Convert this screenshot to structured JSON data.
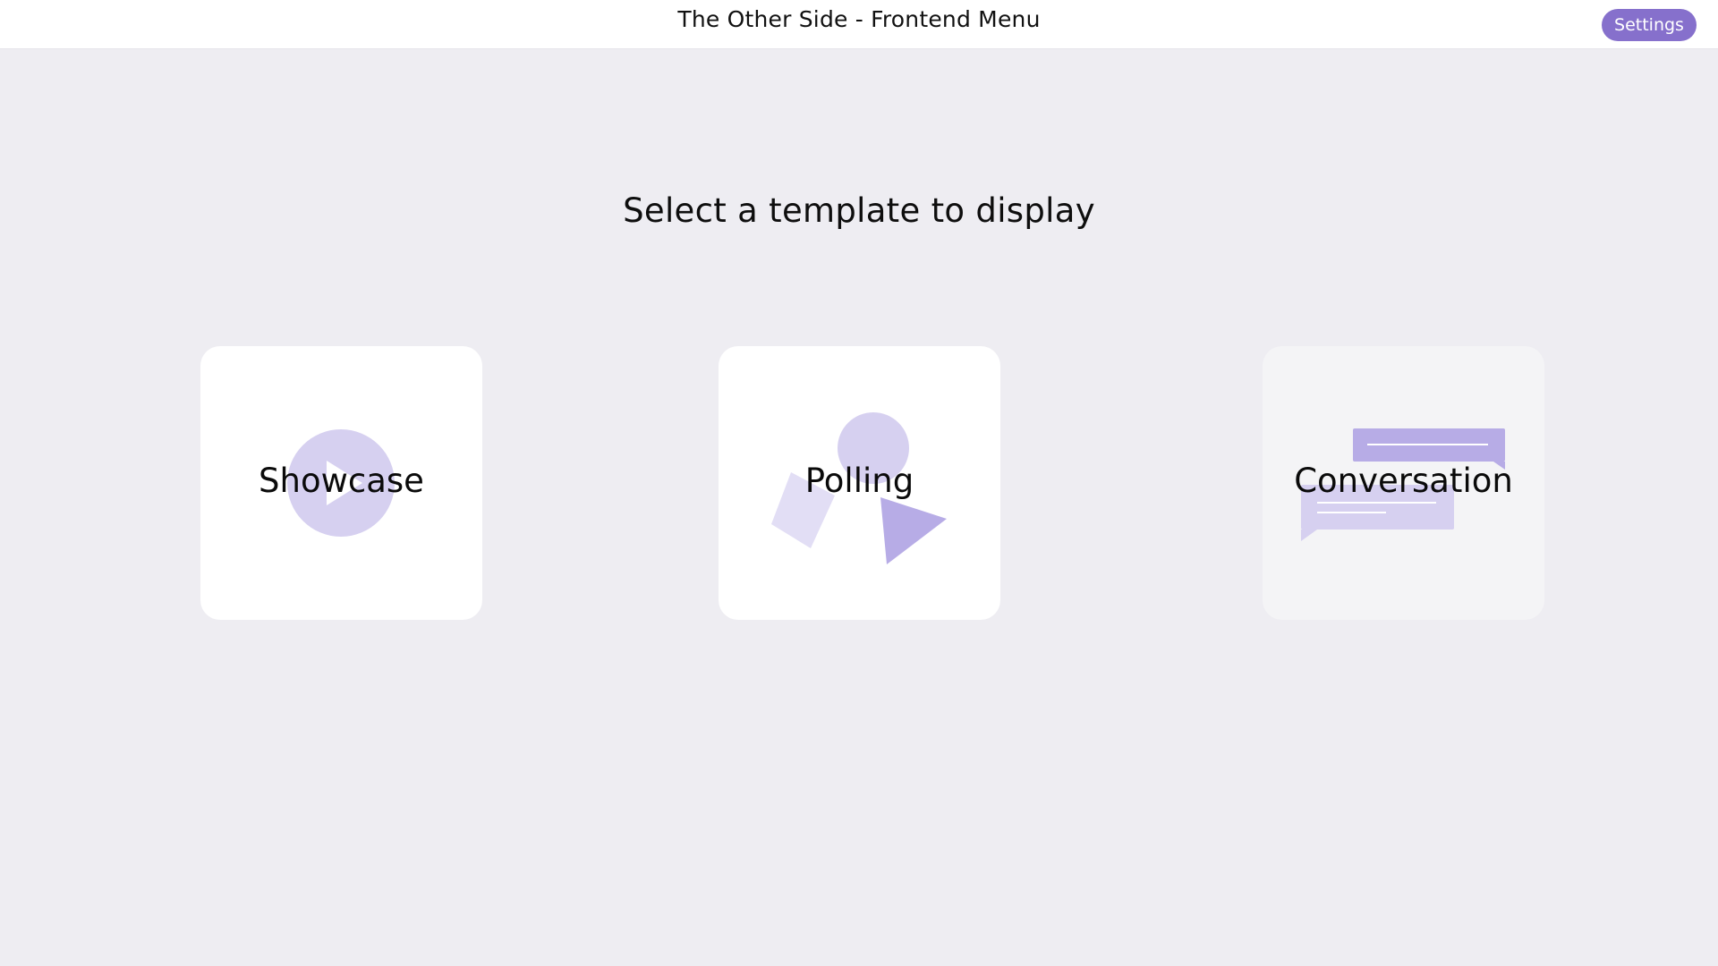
{
  "header": {
    "title": "The Other Side - Frontend Menu",
    "settings_label": "Settings"
  },
  "main": {
    "headline": "Select a template to display",
    "templates": [
      {
        "label": "Showcase",
        "icon": "play-icon"
      },
      {
        "label": "Polling",
        "icon": "shapes-icon"
      },
      {
        "label": "Conversation",
        "icon": "chat-bubbles-icon"
      }
    ]
  },
  "colors": {
    "accent": "#8670cc",
    "illustration_light": "#d6d0f0",
    "illustration_mid": "#b7ace6",
    "background": "#eeedf2"
  }
}
